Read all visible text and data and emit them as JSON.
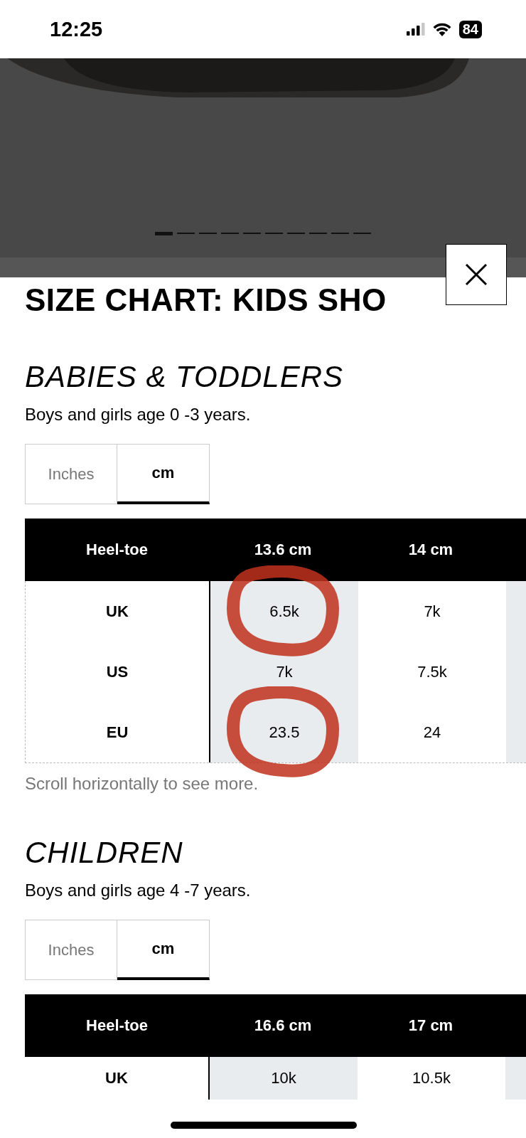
{
  "status_bar": {
    "time": "12:25",
    "battery": "84"
  },
  "gallery": {
    "kind": "picture",
    "pages": [
      {
        "selected": true
      },
      {
        "selected": false
      },
      {
        "selected": false
      },
      {
        "selected": false
      },
      {
        "selected": false
      },
      {
        "selected": false
      },
      {
        "selected": false
      },
      {
        "selected": false
      },
      {
        "selected": false
      },
      {
        "selected": false
      }
    ]
  },
  "title": "SIZE CHART: KIDS SHO",
  "sections": [
    {
      "heading": "BABIES & TODDLERS",
      "description": "Boys and girls age 0 -3 years.",
      "units": [
        {
          "label": "Inches",
          "selected": false
        },
        {
          "label": "cm",
          "selected": true
        }
      ],
      "table": {
        "columns": [
          "Heel-toe",
          "13.6 cm",
          "14 cm"
        ],
        "rows": [
          {
            "cells": [
              {
                "text": "UK",
                "circled": false
              },
              {
                "text": "6.5k",
                "circled": true
              },
              {
                "text": "7k",
                "circled": false
              }
            ]
          },
          {
            "cells": [
              {
                "text": "US",
                "circled": false
              },
              {
                "text": "7k",
                "circled": false
              },
              {
                "text": "7.5k",
                "circled": false
              }
            ]
          },
          {
            "cells": [
              {
                "text": "EU",
                "circled": false
              },
              {
                "text": "23.5",
                "circled": true
              },
              {
                "text": "24",
                "circled": false
              }
            ]
          }
        ]
      },
      "note": "Scroll horizontally to see more."
    },
    {
      "heading": "CHILDREN",
      "description": "Boys and girls age 4 -7 years.",
      "units": [
        {
          "label": "Inches",
          "selected": false
        },
        {
          "label": "cm",
          "selected": true
        }
      ],
      "table": {
        "columns": [
          "Heel-toe",
          "16.6 cm",
          "17 cm"
        ],
        "rows": [
          {
            "cells": [
              {
                "text": "UK",
                "circled": false
              },
              {
                "text": "10k",
                "circled": false
              },
              {
                "text": "10.5k",
                "circled": false
              }
            ]
          }
        ]
      }
    }
  ]
}
